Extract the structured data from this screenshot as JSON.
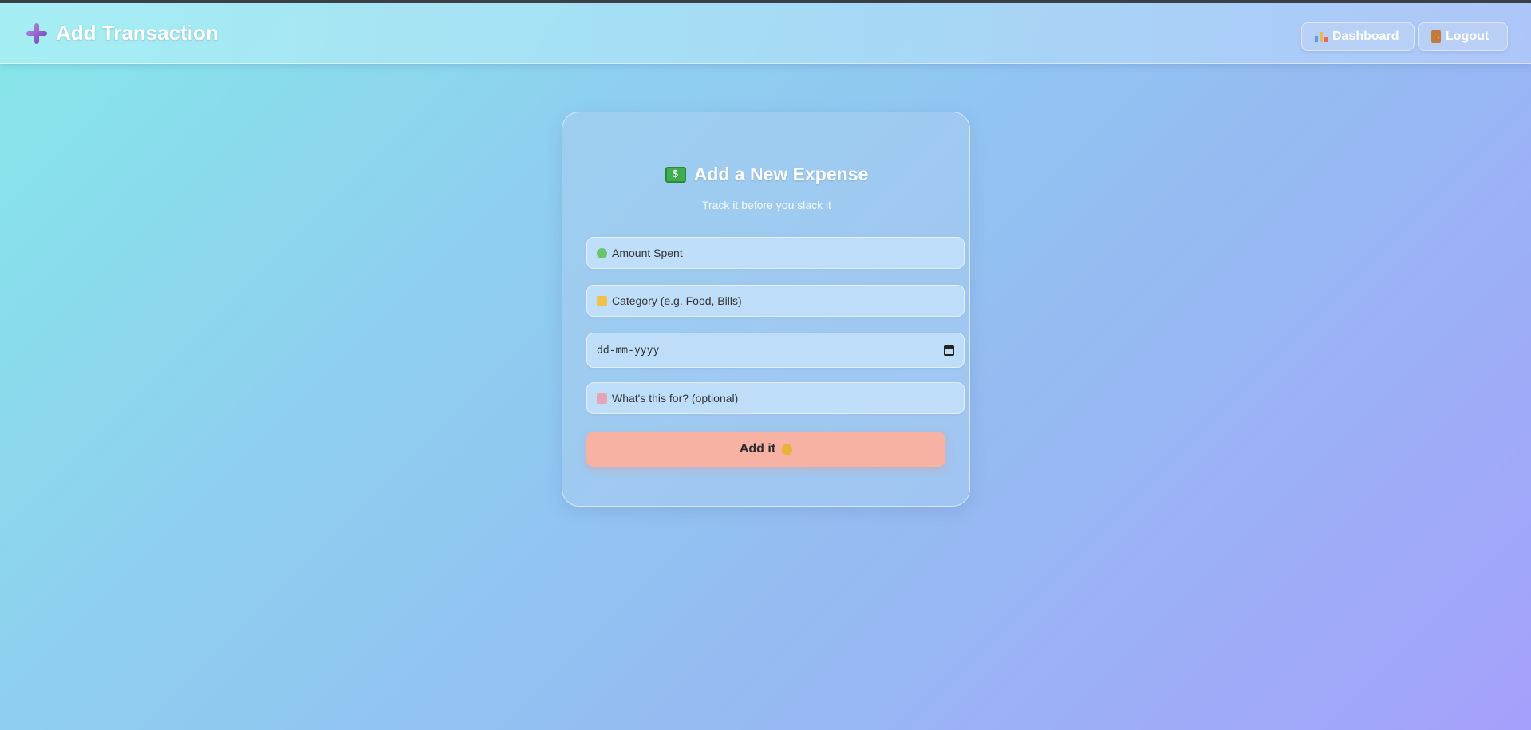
{
  "header": {
    "title": "Add Transaction",
    "nav": {
      "dashboard_label": "Dashboard",
      "logout_label": "Logout"
    }
  },
  "card": {
    "title": "Add a New Expense",
    "subtitle": "Track it before you slack it",
    "fields": {
      "amount_placeholder": "Amount Spent",
      "category_placeholder": "Category (e.g. Food, Bills)",
      "date_placeholder": "dd-mm-yyyy",
      "note_placeholder": "What's this for? (optional)"
    },
    "submit_label": "Add it"
  },
  "colors": {
    "accent_button": "#f8b2a3",
    "text_light": "#ffffff"
  },
  "icons": {
    "brand": "plus-icon",
    "dashboard": "bar-chart-icon",
    "logout": "door-icon",
    "title": "money-icon",
    "amount": "money-flying-icon",
    "category": "folder-icon",
    "note": "memo-icon",
    "submit": "money-bag-icon"
  }
}
